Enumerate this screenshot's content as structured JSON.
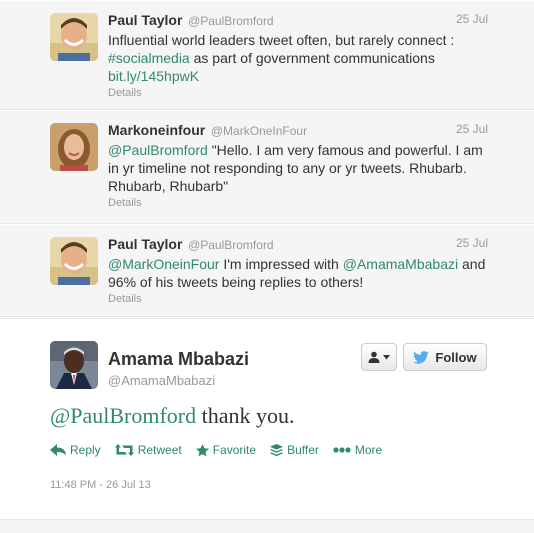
{
  "tweets": [
    {
      "name": "Paul Taylor",
      "handle": "@PaulBromford",
      "time": "25 Jul",
      "text_parts": [
        "Influential world leaders tweet often, but rarely connect : ",
        "#socialmedia",
        " as part of  government communications ",
        "bit.ly/145hpwK"
      ],
      "details": "Details"
    },
    {
      "name": "Markoneinfour",
      "handle": "@MarkOneInFour",
      "time": "25 Jul",
      "text_parts": [
        "@PaulBromford",
        " \"Hello.  I am very  famous and powerful.  I am in yr timeline not responding to any or yr tweets. Rhubarb. Rhubarb, Rhubarb\""
      ],
      "details": "Details"
    },
    {
      "name": "Paul Taylor",
      "handle": "@PaulBromford",
      "time": "25 Jul",
      "text_parts": [
        "@MarkOneinFour",
        " I'm impressed with ",
        "@AmamaMbabazi",
        " and 96% of his tweets being replies to others!"
      ],
      "details": "Details"
    }
  ],
  "main": {
    "name": "Amama Mbabazi",
    "handle": "@AmamaMbabazi",
    "follow_label": "Follow",
    "mention": "@PaulBromford",
    "text": " thank you.",
    "actions": {
      "reply": "Reply",
      "retweet": "Retweet",
      "favorite": "Favorite",
      "buffer": "Buffer",
      "more": "More"
    },
    "timestamp": "11:48 PM - 26 Jul 13"
  },
  "colors": {
    "link": "#308b66",
    "twitter_bird": "#55acee",
    "muted": "#999999"
  }
}
